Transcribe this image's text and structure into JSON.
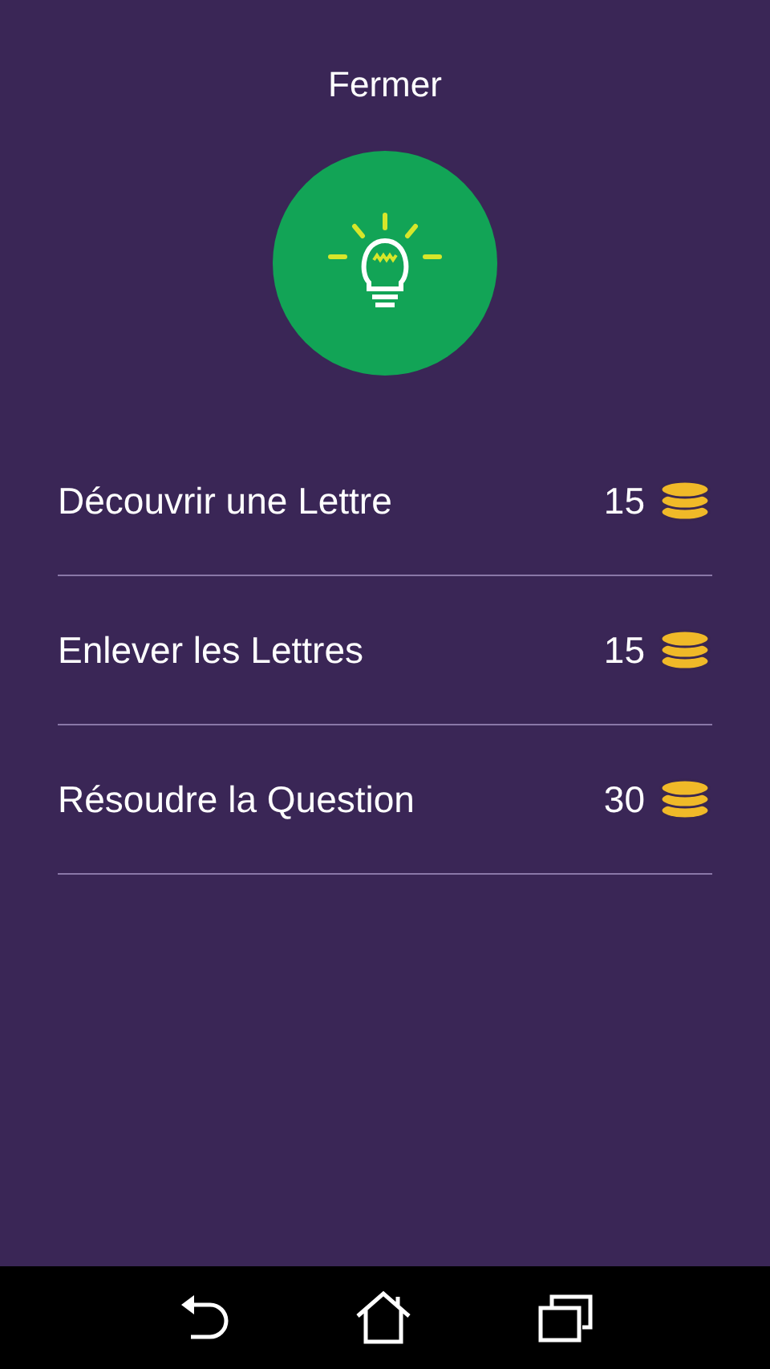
{
  "close_button": "Fermer",
  "hints": [
    {
      "label": "Découvrir une Lettre",
      "cost": "15"
    },
    {
      "label": "Enlever les Lettres",
      "cost": "15"
    },
    {
      "label": "Résoudre la Question",
      "cost": "30"
    }
  ]
}
